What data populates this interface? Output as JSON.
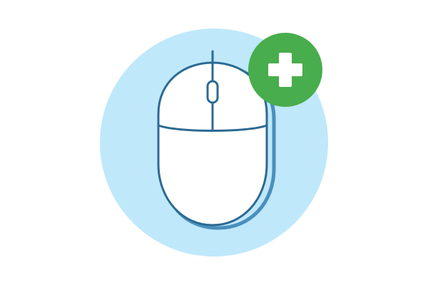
{
  "illustration": {
    "icons": {
      "background": "circle-background",
      "main": "computer-mouse-icon",
      "badge": "plus-badge-icon"
    },
    "colors": {
      "page_background": "#ffffff",
      "circle_fill": "#bfe8fb",
      "mouse_body": "#ffffff",
      "mouse_outline": "#2c6a92",
      "mouse_shadow": "#4a8fbd",
      "badge_fill": "#48ad4c",
      "badge_plus": "#ffffff"
    }
  }
}
